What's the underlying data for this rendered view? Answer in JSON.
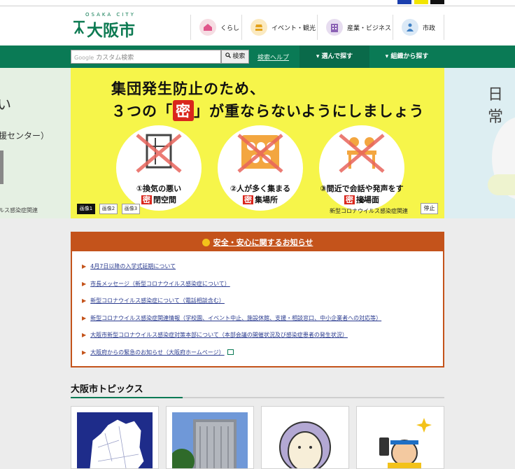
{
  "header": {
    "logo_sub": "OSAKA CITY",
    "logo_name": "大阪市",
    "nav": [
      {
        "label": "くらし",
        "icon": "house-icon",
        "color": "#f6dde3"
      },
      {
        "label": "イベント・観光",
        "icon": "event-icon",
        "color": "#fbeac1"
      },
      {
        "label": "産業・ビジネス",
        "icon": "building-icon",
        "color": "#e7ddf0"
      },
      {
        "label": "市政",
        "icon": "people-icon",
        "color": "#dbe9f6"
      }
    ]
  },
  "searchbar": {
    "placeholder_prefix": "Google",
    "placeholder": "カスタム検索",
    "button": "検索",
    "help": "検索ヘルプ",
    "choose": "選んで探す",
    "org": "組織から探す"
  },
  "hero_left": {
    "title": "い",
    "sub": "援センター）",
    "note": "ルス感染症関連"
  },
  "hero": {
    "line1": "集団発生防止のため、",
    "line2_a": "３つの「",
    "line2_mitsu": "密",
    "line2_b": "」が重ならないようにしましょう",
    "items": [
      {
        "cap1": "①換気の悪い",
        "mark": "密",
        "cap2": "閉空間"
      },
      {
        "cap1": "②人が多く集まる",
        "mark": "密",
        "cap2": "集場所"
      },
      {
        "cap1": "③間近で会話や発声をする",
        "mark": "密",
        "cap2": "接場面"
      }
    ],
    "pagers": [
      "画像1",
      "画像2",
      "画像3"
    ],
    "caption": "新型コロナウイルス感染症関連",
    "stop": "停止"
  },
  "hero_right": {
    "title": "日常"
  },
  "notice": {
    "title": "安全・安心に関するお知らせ",
    "items": [
      "4月7日以降の入学式延期について",
      "市長メッセージ（新型コロナウイルス感染症について）",
      "新型コロナウイルス感染症について（電話相談含む）",
      "新型コロナウイルス感染症関連情報（学校園、イベント中止、施設休館、支援・相談窓口、中小企業者への対応等）",
      "大阪市新型コロナウイルス感染症対策本部について（本部会議の開催状況及び感染症患者の発生状況）",
      "大阪府からの緊急のお知らせ（大阪府ホームページ）"
    ]
  },
  "topics": {
    "title": "大阪市トピックス"
  }
}
